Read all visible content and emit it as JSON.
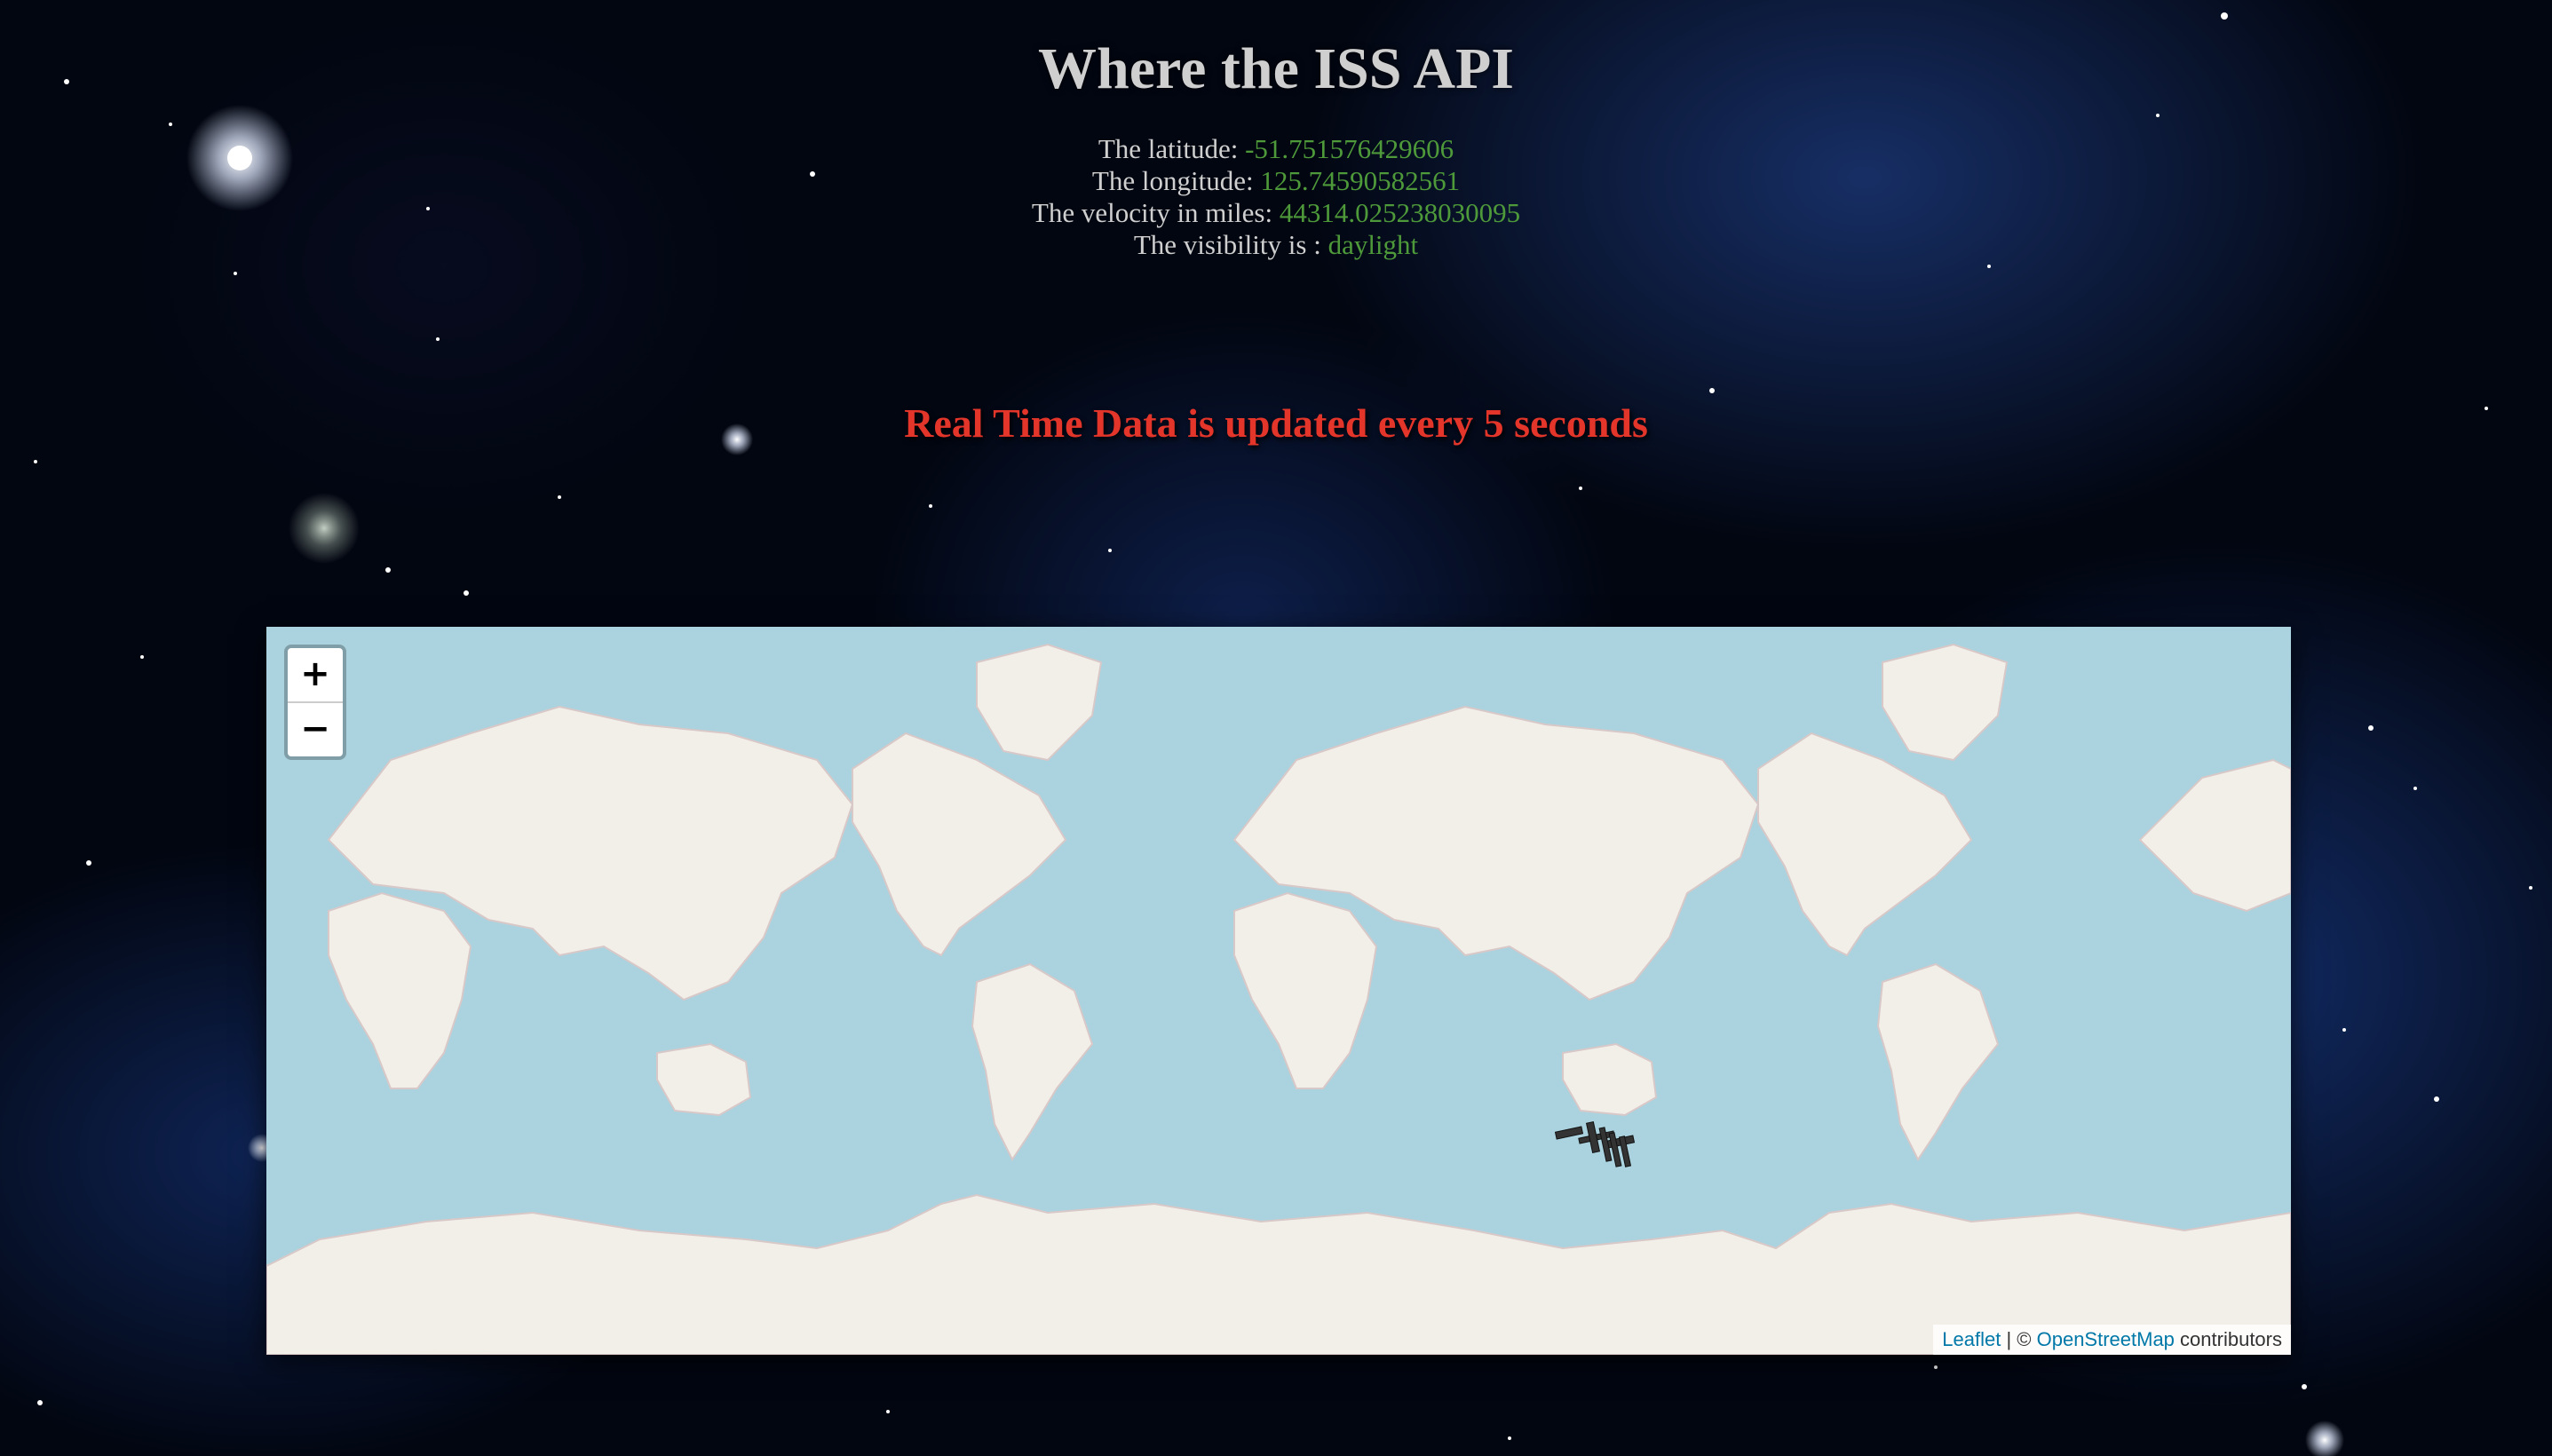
{
  "page": {
    "title": "Where the ISS API"
  },
  "stats": {
    "latitude_label": "The latitude:",
    "latitude_value": "-51.751576429606",
    "longitude_label": "The longitude:",
    "longitude_value": "125.74590582561",
    "velocity_label": "The velocity in miles:",
    "velocity_value": "44314.025238030095",
    "visibility_label": "The visibility is :",
    "visibility_value": "daylight"
  },
  "notice": "Real Time Data is updated every 5 seconds",
  "map": {
    "zoom_in": "+",
    "zoom_out": "−",
    "attribution": {
      "leaflet": "Leaflet",
      "separator": "| ©",
      "osm": "OpenStreetMap",
      "suffix": "contributors"
    },
    "marker_icon": "iss-icon"
  },
  "colors": {
    "value_green": "#4e9a3a",
    "notice_red": "#e3352a",
    "ocean": "#aad3df",
    "land": "#f2efe9"
  }
}
